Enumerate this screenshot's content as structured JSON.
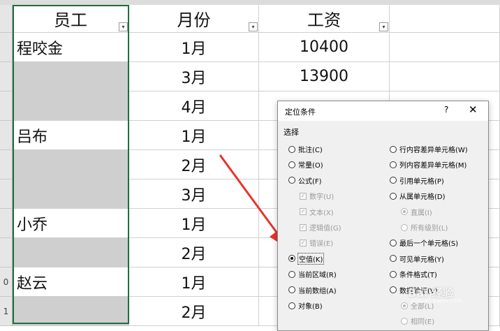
{
  "headers": {
    "employee": "员工",
    "month": "月份",
    "salary": "工资"
  },
  "row_numbers": [
    "",
    "",
    "",
    "",
    "",
    "",
    "",
    "",
    "0",
    "1"
  ],
  "rows": [
    {
      "employee": "程咬金",
      "month": "1月",
      "salary": "10400",
      "gray": false
    },
    {
      "employee": "",
      "month": "3月",
      "salary": "13900",
      "gray": true
    },
    {
      "employee": "",
      "month": "4月",
      "salary": "",
      "gray": true
    },
    {
      "employee": "吕布",
      "month": "1月",
      "salary": "",
      "gray": false
    },
    {
      "employee": "",
      "month": "2月",
      "salary": "",
      "gray": true
    },
    {
      "employee": "",
      "month": "3月",
      "salary": "",
      "gray": true
    },
    {
      "employee": "小乔",
      "month": "1月",
      "salary": "",
      "gray": false
    },
    {
      "employee": "",
      "month": "2月",
      "salary": "",
      "gray": true
    },
    {
      "employee": "赵云",
      "month": "1月",
      "salary": "",
      "gray": false
    },
    {
      "employee": "",
      "month": "2月",
      "salary": "",
      "gray": true
    }
  ],
  "dialog": {
    "title": "定位条件",
    "help": "?",
    "close": "✕",
    "section": "选择",
    "left_options": [
      {
        "label": "批注(C)",
        "state": "normal"
      },
      {
        "label": "常量(O)",
        "state": "normal"
      },
      {
        "label": "公式(F)",
        "state": "normal"
      },
      {
        "label": "数字(U)",
        "state": "check-disabled"
      },
      {
        "label": "文本(X)",
        "state": "check-disabled"
      },
      {
        "label": "逻辑值(G)",
        "state": "check-disabled"
      },
      {
        "label": "错误(E)",
        "state": "check-disabled"
      },
      {
        "label": "空值(K)",
        "state": "selected"
      },
      {
        "label": "当前区域(R)",
        "state": "normal"
      },
      {
        "label": "当前数组(A)",
        "state": "normal"
      },
      {
        "label": "对象(B)",
        "state": "normal"
      }
    ],
    "right_options": [
      {
        "label": "行内容差异单元格(W)",
        "state": "normal"
      },
      {
        "label": "列内容差异单元格(M)",
        "state": "normal"
      },
      {
        "label": "引用单元格(P)",
        "state": "normal"
      },
      {
        "label": "从属单元格(D)",
        "state": "normal"
      },
      {
        "label": "直属(I)",
        "state": "radio-disabled-on"
      },
      {
        "label": "所有级别(L)",
        "state": "radio-disabled"
      },
      {
        "label": "最后一个单元格(S)",
        "state": "normal"
      },
      {
        "label": "可见单元格(Y)",
        "state": "normal"
      },
      {
        "label": "条件格式(T)",
        "state": "normal"
      },
      {
        "label": "数据验证(V)",
        "state": "normal"
      },
      {
        "label": "全部(L)",
        "state": "radio-disabled-on"
      },
      {
        "label": "相同(E)",
        "state": "radio-disabled"
      }
    ]
  },
  "watermark": {
    "text": "Bai 经验",
    "sub": "jingyan.baidu.com"
  },
  "colors": {
    "arrow": "#e8332c",
    "selection": "#1e6e3c",
    "blank_fill": "#cfcfcf"
  }
}
